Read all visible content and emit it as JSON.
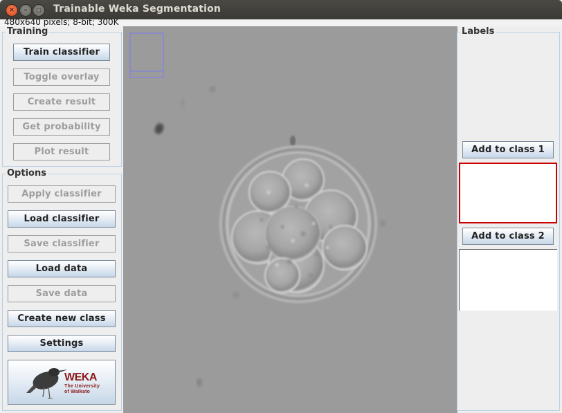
{
  "window": {
    "title": "Trainable Weka Segmentation",
    "controls": {
      "close": "×",
      "minimize": "–",
      "maximize": "▢"
    }
  },
  "image_info": "480x640 pixels; 8-bit; 300K",
  "training": {
    "legend": "Training",
    "buttons": [
      {
        "label": "Train classifier",
        "enabled": true
      },
      {
        "label": "Toggle overlay",
        "enabled": false
      },
      {
        "label": "Create result",
        "enabled": false
      },
      {
        "label": "Get probability",
        "enabled": false
      },
      {
        "label": "Plot result",
        "enabled": false
      }
    ]
  },
  "options": {
    "legend": "Options",
    "buttons": [
      {
        "label": "Apply classifier",
        "enabled": false
      },
      {
        "label": "Load classifier",
        "enabled": true
      },
      {
        "label": "Save classifier",
        "enabled": false
      },
      {
        "label": "Load data",
        "enabled": true
      },
      {
        "label": "Save data",
        "enabled": false
      },
      {
        "label": "Create new class",
        "enabled": true
      },
      {
        "label": "Settings",
        "enabled": true
      }
    ],
    "logo": {
      "title": "WEKA",
      "line1": "The University",
      "line2": "of Waikato"
    }
  },
  "labels": {
    "legend": "Labels",
    "classes": [
      {
        "button": "Add to class 1",
        "border_color": "#cc0000"
      },
      {
        "button": "Add to class 2",
        "border_color": "#555555"
      }
    ]
  },
  "canvas": {
    "description": "embryo microscopy image",
    "overview_box_color": "#7b7bf5"
  }
}
